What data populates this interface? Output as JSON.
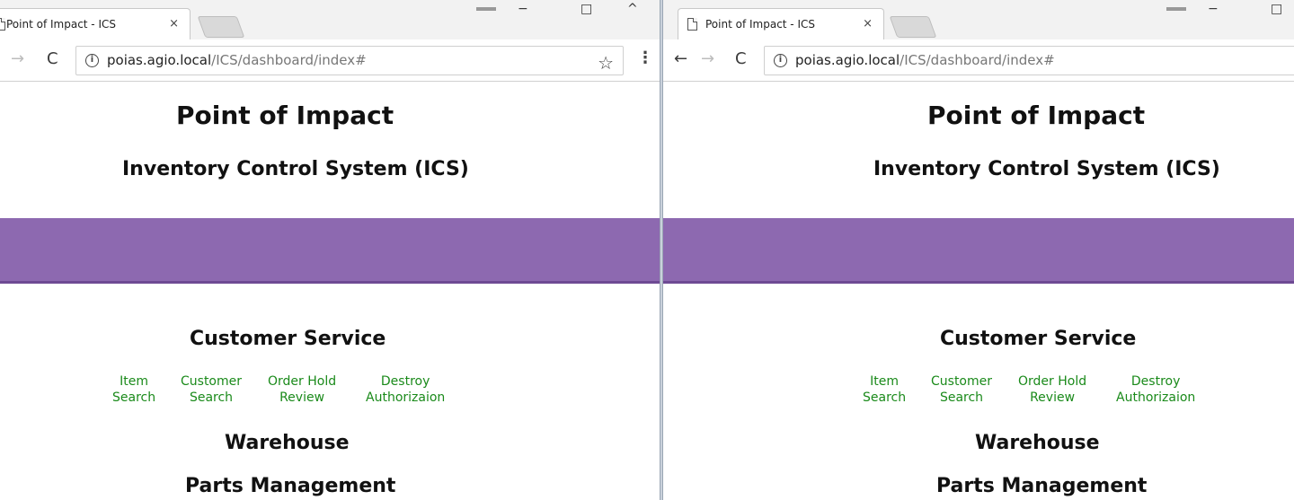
{
  "browser": {
    "tab_title": "Point of Impact - ICS",
    "tab_close": "×",
    "url_host": "poias.agio.local",
    "url_path": "/ICS/dashboard/index#",
    "info_icon": "i",
    "icons": {
      "back": "back-arrow-icon",
      "forward": "forward-arrow-icon",
      "reload": "reload-icon",
      "star": "bookmark-star-icon",
      "menu": "menu-kebab-icon"
    },
    "glyphs": {
      "back": "←",
      "forward": "→",
      "reload": "C",
      "star": "☆",
      "menu": "⋮",
      "restore": "□",
      "chevron": "^"
    }
  },
  "page": {
    "title": "Point of Impact",
    "subtitle": "Inventory Control System (ICS)",
    "banner_color": "#8d69b0",
    "link_color": "#1a8a1a",
    "sections": {
      "customer_service": "Customer Service",
      "warehouse": "Warehouse",
      "parts_management": "Parts Management"
    },
    "links": [
      {
        "line1": "Item",
        "line2": "Search"
      },
      {
        "line1": "Customer",
        "line2": "Search"
      },
      {
        "line1": "Order Hold",
        "line2": "Review"
      },
      {
        "line1": "Destroy",
        "line2": "Authorizaion"
      }
    ]
  }
}
